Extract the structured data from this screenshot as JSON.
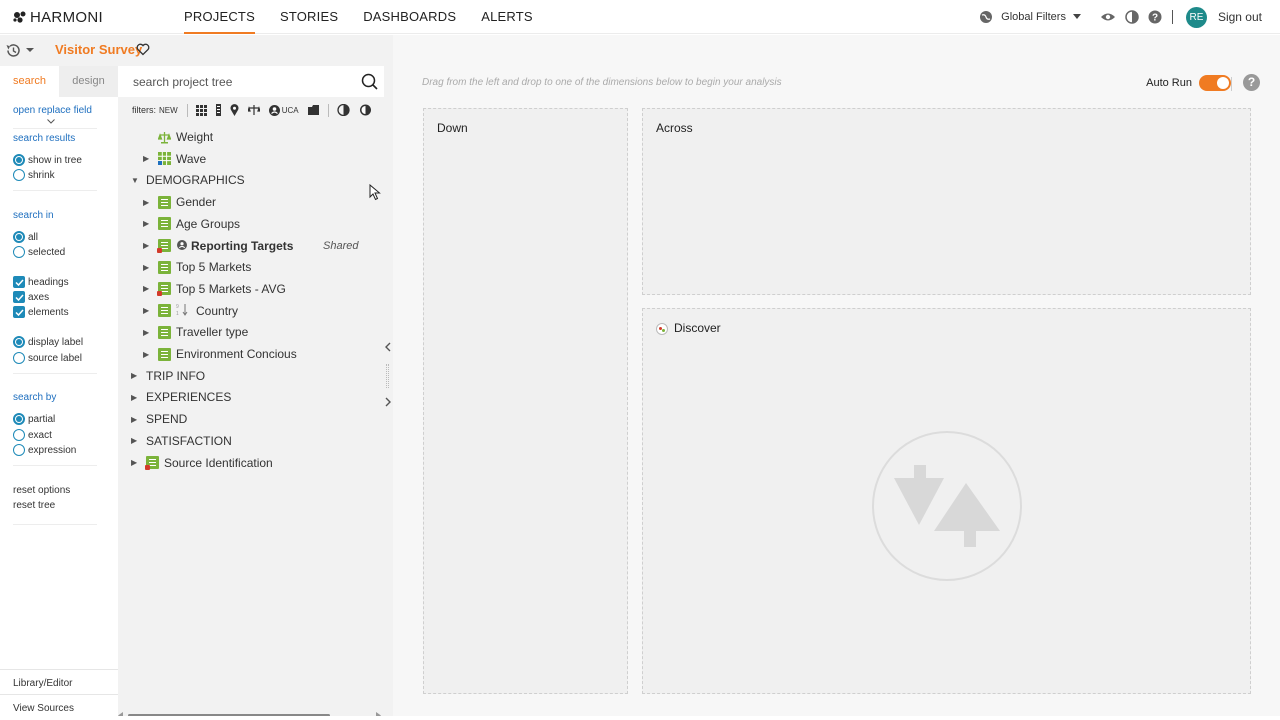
{
  "app": {
    "logo_text": "HARMONI",
    "nav": [
      {
        "label": "PROJECTS",
        "active": true
      },
      {
        "label": "STORIES",
        "active": false
      },
      {
        "label": "DASHBOARDS",
        "active": false
      },
      {
        "label": "ALERTS",
        "active": false
      }
    ],
    "global_filters": "Global Filters",
    "avatar": "RE",
    "sign_out": "Sign out",
    "accent": "#f07b22"
  },
  "project": {
    "title": "Visitor Survey"
  },
  "left_panel": {
    "tabs": [
      {
        "label": "search",
        "active": true
      },
      {
        "label": "design",
        "active": false
      }
    ],
    "open_replace": "open replace field",
    "search_results": {
      "heading": "search results",
      "options": [
        {
          "label": "show in tree",
          "checked": true
        },
        {
          "label": "shrink",
          "checked": false
        }
      ]
    },
    "search_in": {
      "heading": "search in",
      "scope": [
        {
          "label": "all",
          "checked": true
        },
        {
          "label": "selected",
          "checked": false
        }
      ],
      "types": [
        {
          "label": "headings",
          "checked": true
        },
        {
          "label": "axes",
          "checked": true
        },
        {
          "label": "elements",
          "checked": true
        }
      ],
      "label_mode": [
        {
          "label": "display label",
          "checked": true
        },
        {
          "label": "source label",
          "checked": false
        }
      ]
    },
    "search_by": {
      "heading": "search by",
      "options": [
        {
          "label": "partial",
          "checked": true
        },
        {
          "label": "exact",
          "checked": false
        },
        {
          "label": "expression",
          "checked": false
        }
      ]
    },
    "reset_options": "reset options",
    "reset_tree": "reset tree",
    "library_editor": "Library/Editor",
    "view_sources": "View Sources"
  },
  "tree": {
    "search_placeholder": "search project tree",
    "filters_label": "filters:",
    "filter_new": "NEW",
    "filter_uca": "UCA",
    "items": [
      {
        "label": "Weight",
        "level": 1,
        "caret": "",
        "icon": "weight-icon"
      },
      {
        "label": "Wave",
        "level": 1,
        "caret": "right",
        "icon": "grid-variable-icon"
      },
      {
        "label": "DEMOGRAPHICS",
        "level": 0,
        "caret": "down",
        "icon": ""
      },
      {
        "label": "Gender",
        "level": 1,
        "caret": "right",
        "icon": "variable-icon"
      },
      {
        "label": "Age Groups",
        "level": 1,
        "caret": "right",
        "icon": "variable-icon"
      },
      {
        "label": "Reporting Targets",
        "level": 1,
        "caret": "right",
        "icon": "variable-shared-icon",
        "bold": true,
        "tag": "Shared"
      },
      {
        "label": "Top 5 Markets",
        "level": 1,
        "caret": "right",
        "icon": "variable-icon"
      },
      {
        "label": "Top 5 Markets - AVG",
        "level": 1,
        "caret": "right",
        "icon": "variable-derived-icon"
      },
      {
        "label": "Country",
        "level": 1,
        "caret": "right",
        "icon": "variable-sort-icon"
      },
      {
        "label": "Traveller type",
        "level": 1,
        "caret": "right",
        "icon": "variable-icon"
      },
      {
        "label": "Environment Concious",
        "level": 1,
        "caret": "right",
        "icon": "variable-icon"
      },
      {
        "label": "TRIP INFO",
        "level": 0,
        "caret": "right",
        "icon": ""
      },
      {
        "label": "EXPERIENCES",
        "level": 0,
        "caret": "right",
        "icon": ""
      },
      {
        "label": "SPEND",
        "level": 0,
        "caret": "right",
        "icon": ""
      },
      {
        "label": "SATISFACTION",
        "level": 0,
        "caret": "right",
        "icon": ""
      },
      {
        "label": "Source Identification",
        "level": 0,
        "caret": "right",
        "icon": "variable-derived-icon"
      }
    ]
  },
  "canvas": {
    "hint": "Drag from the left and drop to one of the dimensions below to begin your analysis",
    "auto_run": "Auto Run",
    "auto_run_on": true,
    "zones": {
      "down": "Down",
      "across": "Across",
      "discover": "Discover"
    }
  }
}
